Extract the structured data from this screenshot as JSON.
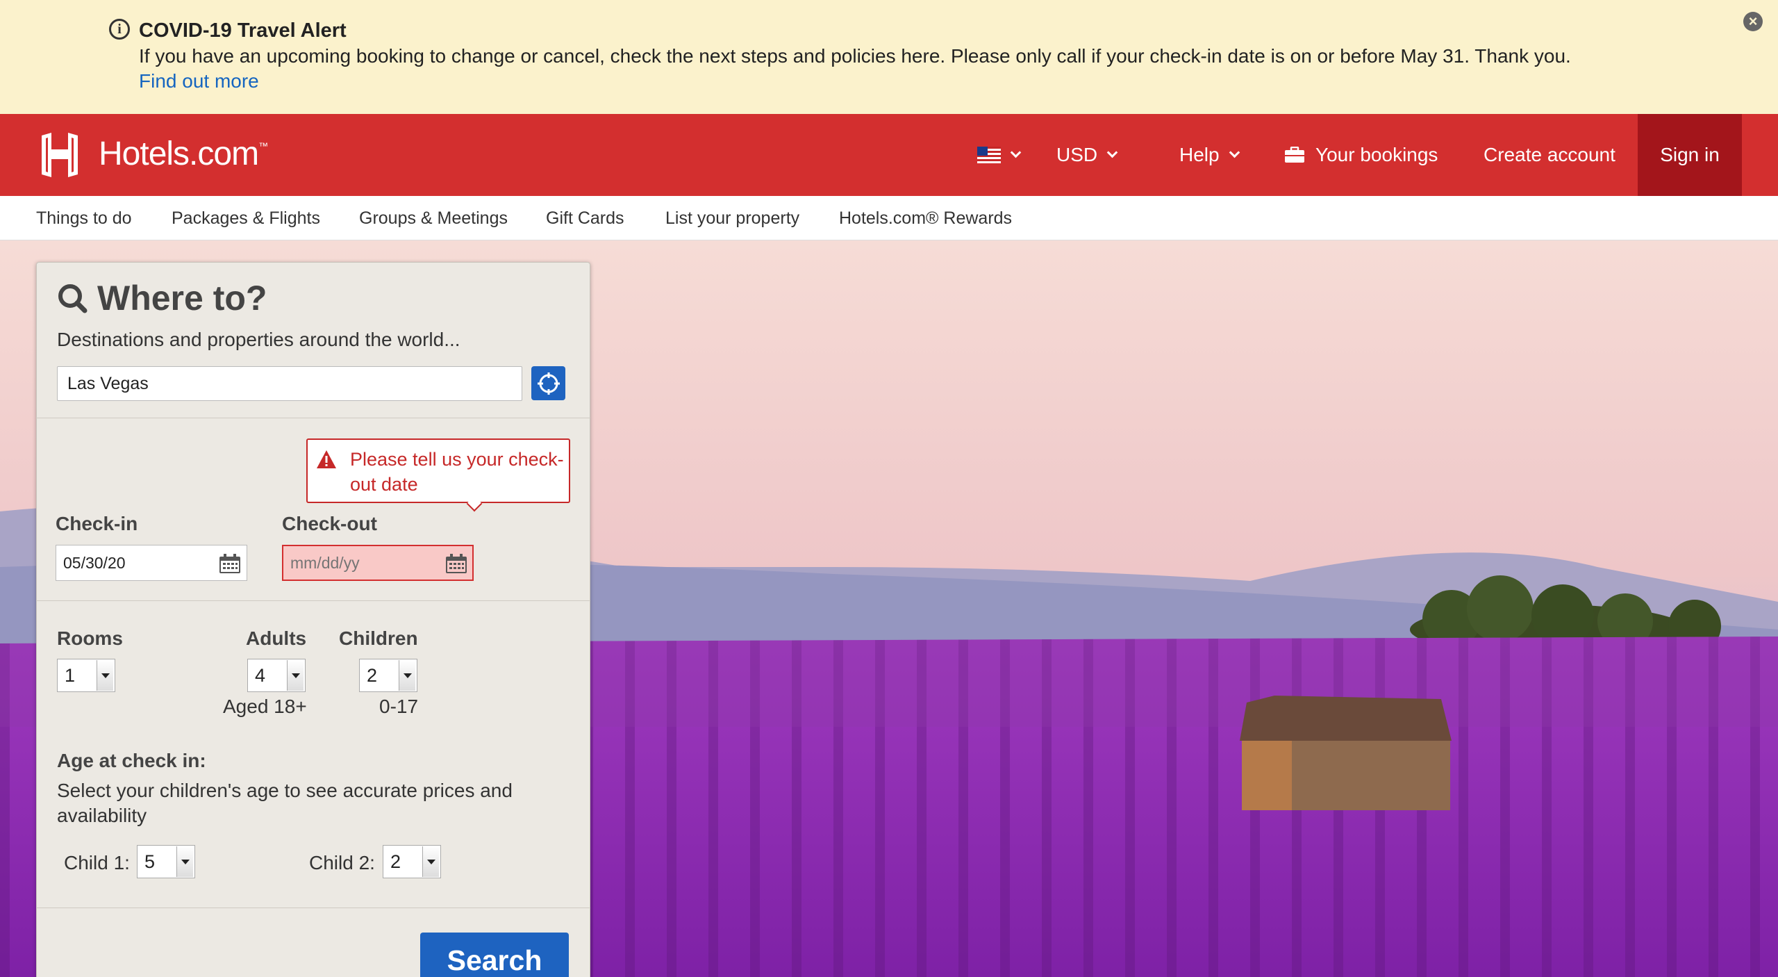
{
  "alert": {
    "title": "COVID-19 Travel Alert",
    "body": "If you have an upcoming booking to change or cancel, check the next steps and policies here. Please only call if your check-in date is on or before May 31. Thank you.",
    "link": "Find out more",
    "close_icon": "close-icon"
  },
  "header": {
    "brand": "Hotels.com",
    "trademark": "™",
    "flag": "us-flag-icon",
    "currency": "USD",
    "help": "Help",
    "bookings": "Your bookings",
    "create_account": "Create account",
    "sign_in": "Sign in"
  },
  "subnav": [
    "Things to do",
    "Packages & Flights",
    "Groups & Meetings",
    "Gift Cards",
    "List your property",
    "Hotels.com® Rewards"
  ],
  "search": {
    "title": "Where to?",
    "subtitle": "Destinations and properties around the world...",
    "destination": "Las Vegas",
    "error": "Please tell us your check-out date",
    "checkin_label": "Check-in",
    "checkin_value": "05/30/20",
    "checkout_label": "Check-out",
    "checkout_placeholder": "mm/dd/yy",
    "rooms_label": "Rooms",
    "rooms": "1",
    "adults_label": "Adults",
    "adults": "4",
    "adults_note": "Aged 18+",
    "children_label": "Children",
    "children": "2",
    "children_note": "0-17",
    "age_heading": "Age at check in:",
    "age_help": "Select your children's age to see accurate prices and availability",
    "child1_label": "Child 1:",
    "child1": "5",
    "child2_label": "Child 2:",
    "child2": "2",
    "search_button": "Search"
  },
  "colors": {
    "brand_red": "#d32f2f",
    "sign_in_bg": "#a3151b",
    "alert_bg": "#fbf2cc",
    "action_blue": "#1e63c0",
    "error_red": "#c62828"
  }
}
